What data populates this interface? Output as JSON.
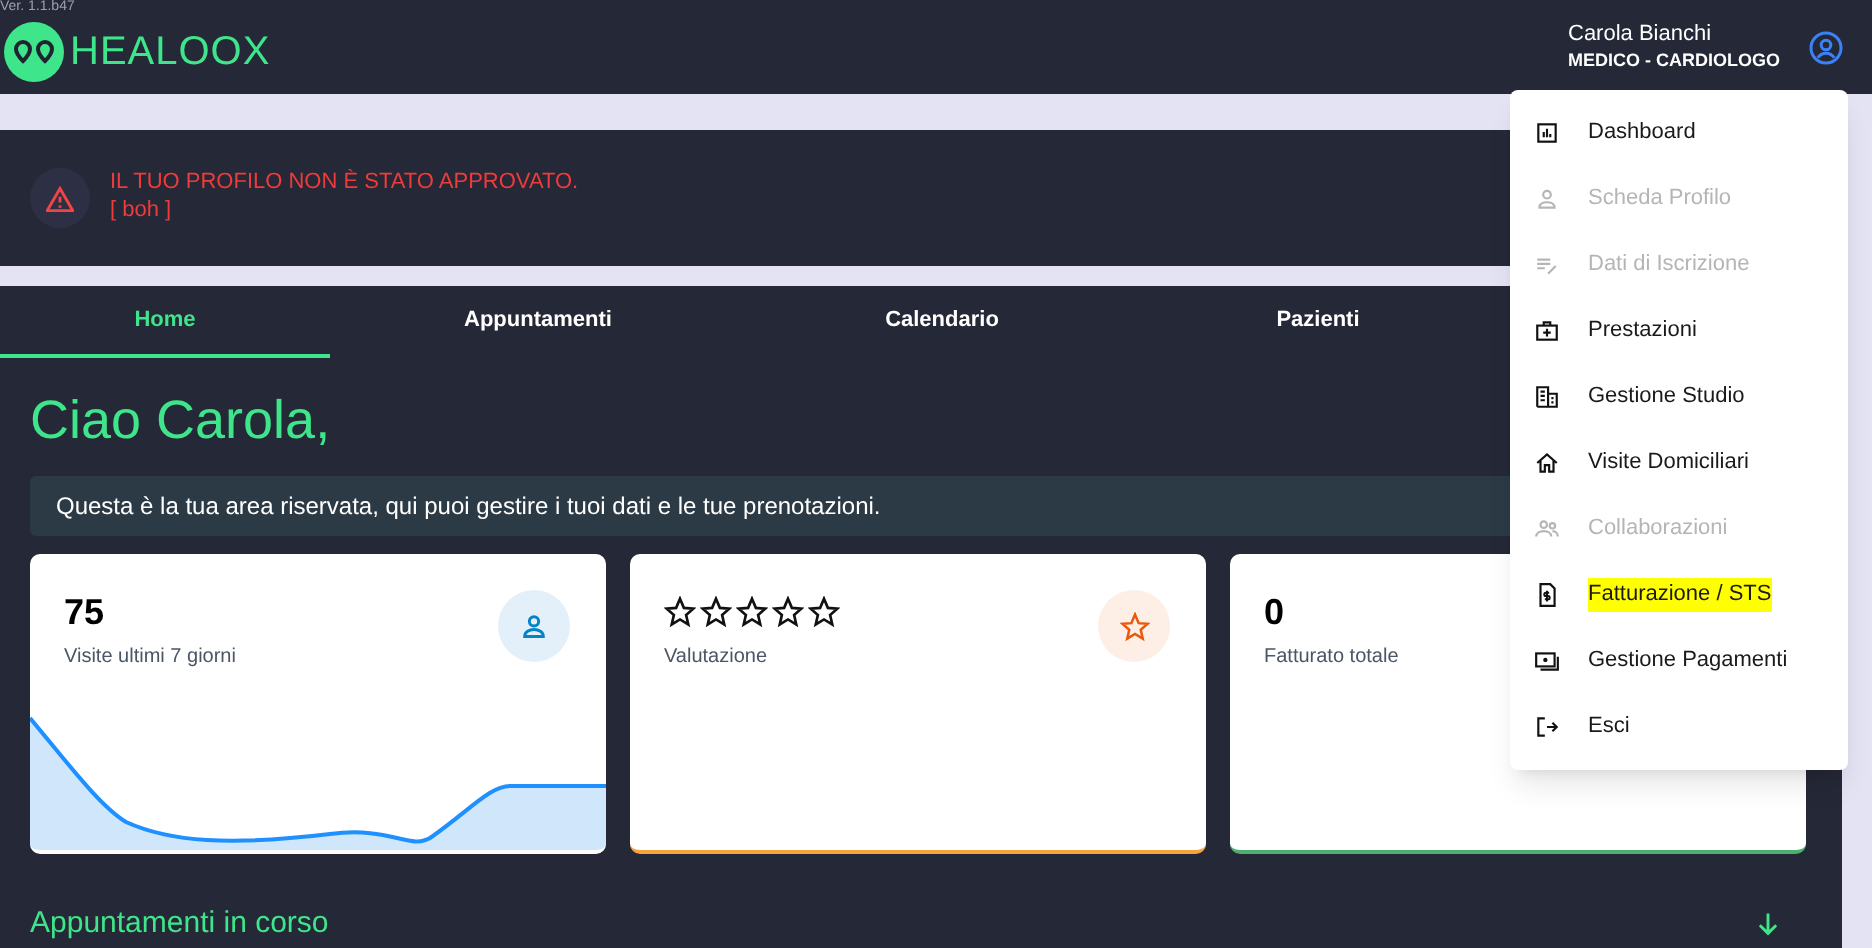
{
  "header": {
    "version": "Ver. 1.1.b47",
    "logo_text": "HEALOOX",
    "user_name": "Carola Bianchi",
    "user_role": "MEDICO - CARDIOLOGO"
  },
  "alert": {
    "title": "IL TUO PROFILO NON È STATO APPROVATO.",
    "detail": "[ boh ]"
  },
  "tabs": [
    {
      "label": "Home",
      "selected": true
    },
    {
      "label": "Appuntamenti",
      "selected": false
    },
    {
      "label": "Calendario",
      "selected": false
    },
    {
      "label": "Pazienti",
      "selected": false
    }
  ],
  "greeting": "Ciao Carola,",
  "info_banner": "Questa è la tua area riservata, qui puoi gestire i tuoi dati e le tue prenotazioni.",
  "cards": [
    {
      "kind": "visits",
      "value": "75",
      "label": "Visite ultimi 7 giorni"
    },
    {
      "kind": "rating",
      "stars": 0,
      "label": "Valutazione"
    },
    {
      "kind": "revenue",
      "value": "0",
      "label": "Fatturato totale"
    }
  ],
  "section_title": "Appuntamenti in corso",
  "user_menu": [
    {
      "kind": "chart",
      "label": "Dashboard",
      "disabled": false,
      "highlighted": false
    },
    {
      "kind": "person",
      "label": "Scheda Profilo",
      "disabled": true,
      "highlighted": false
    },
    {
      "kind": "edit",
      "label": "Dati di Iscrizione",
      "disabled": true,
      "highlighted": false
    },
    {
      "kind": "kit",
      "label": "Prestazioni",
      "disabled": false,
      "highlighted": false
    },
    {
      "kind": "building",
      "label": "Gestione Studio",
      "disabled": false,
      "highlighted": false
    },
    {
      "kind": "home",
      "label": "Visite Domiciliari",
      "disabled": false,
      "highlighted": false
    },
    {
      "kind": "people",
      "label": "Collaborazioni",
      "disabled": true,
      "highlighted": false
    },
    {
      "kind": "invoice",
      "label": "Fatturazione / STS",
      "disabled": false,
      "highlighted": true
    },
    {
      "kind": "payment",
      "label": "Gestione Pagamenti",
      "disabled": false,
      "highlighted": false
    },
    {
      "kind": "logout",
      "label": "Esci",
      "disabled": false,
      "highlighted": false
    }
  ]
}
